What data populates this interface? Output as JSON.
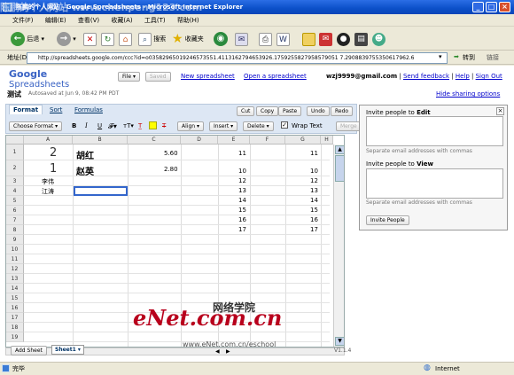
{
  "browser": {
    "title": "陈鹏的个人网站 - Google Spreadsheets - Microsoft Internet Explorer",
    "menu": [
      "文件(F)",
      "编辑(E)",
      "查看(V)",
      "收藏(A)",
      "工具(T)",
      "帮助(H)"
    ],
    "toolbar": {
      "back": "后退",
      "search": "搜索",
      "favorites": "收藏夹"
    },
    "address_label": "地址(D)",
    "url": "http://spreadsheets.google.com/ccc?id=o03582965019246573551.4113162794653926.1759255827958579051 7.2908839755350617962.6",
    "go": "转到",
    "links": "链接",
    "status_left": "完毕",
    "status_right": "Internet"
  },
  "app": {
    "logo_google": "Google",
    "logo_product": "Spreadsheets",
    "file_btn": "File ▾",
    "saved_btn": "Saved",
    "new_link": "New spreadsheet",
    "open_link": "Open a spreadsheet",
    "user_email": "wzj9999@gmail.com",
    "send_feedback": "Send feedback",
    "help": "Help",
    "sign_out": "Sign Out",
    "doc_title": "测试",
    "autosaved": "Autosaved at Jun 9, 08:42 PM PDT",
    "hide_sharing": "Hide sharing options",
    "tabs": [
      "Format",
      "Sort",
      "Formulas"
    ],
    "edit_buttons": [
      "Cut",
      "Copy",
      "Paste",
      "Undo",
      "Redo"
    ],
    "choose_format": "Choose Format ▾",
    "fmt_b": "B",
    "fmt_i": "I",
    "fmt_u": "U",
    "align": "Align ▾",
    "insert": "Insert ▾",
    "delete": "Delete ▾",
    "wrap_text": "Wrap Text",
    "merge": "Merge",
    "add_sheet": "Add Sheet",
    "sheet1": "Sheet1 ▾",
    "version": "V1.1.4"
  },
  "grid": {
    "columns": [
      "A",
      "B",
      "C",
      "D",
      "E",
      "F",
      "G",
      "H"
    ],
    "rows": [
      "1",
      "2",
      "3",
      "4",
      "5",
      "6",
      "7",
      "8",
      "9",
      "10",
      "11",
      "12",
      "13",
      "14",
      "15",
      "16",
      "17",
      "18",
      "19"
    ],
    "cells": {
      "A1": "2",
      "B1": "胡红",
      "C1": "5.60",
      "E1": "11",
      "G1": "11",
      "A2": "1",
      "B2": "赵英",
      "C2": "2.80",
      "E2": "10",
      "G2": "10",
      "A3": "李伟",
      "E3": "12",
      "G3": "12",
      "A4": "江涛",
      "E4": "13",
      "G4": "13",
      "E5": "14",
      "G5": "14",
      "E6": "15",
      "G6": "15",
      "E7": "16",
      "G7": "16",
      "E8": "17",
      "G8": "17"
    }
  },
  "sharing": {
    "edit_title": "Invite people to ",
    "edit_bold": "Edit",
    "edit_hint": "Separate email addresses with commas",
    "view_title": "Invite people to ",
    "view_bold": "View",
    "view_hint": "Separate email addresses with commas",
    "invite_btn": "Invite People",
    "close": "×"
  },
  "watermark": {
    "logo": "eNet.com.cn",
    "chinese": "网络学院",
    "url": "www.eNet.com.cn/eschool",
    "overlay": "陈鹏的个人网站 www.chenpeng123.com"
  }
}
